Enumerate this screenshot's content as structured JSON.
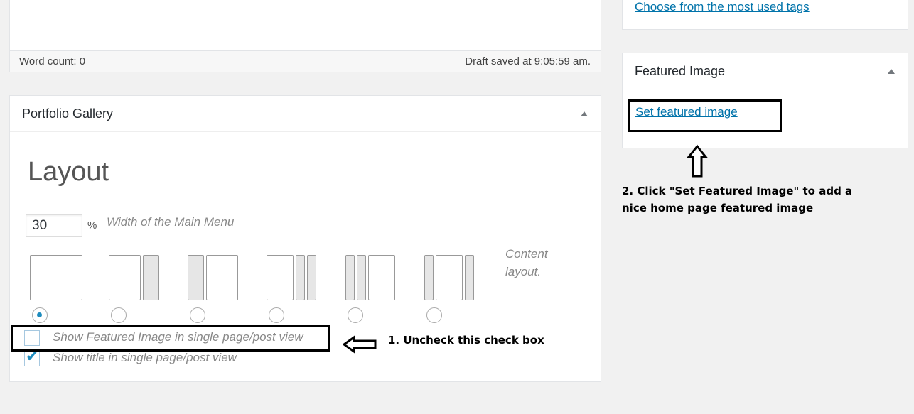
{
  "editor": {
    "word_count": "Word count: 0",
    "draft_status": "Draft saved at 9:05:59 am."
  },
  "portfolio_gallery": {
    "title": "Portfolio Gallery",
    "layout_heading": "Layout",
    "width_value": "30",
    "width_unit": "%",
    "width_label": "Width of the Main Menu",
    "content_layout_label_1": "Content",
    "content_layout_label_2": "layout.",
    "layout_options_selected_index": 0,
    "checkboxes": [
      {
        "label": "Show Featured Image in single page/post view",
        "checked": false
      },
      {
        "label": "Show title in single page/post view",
        "checked": true
      }
    ]
  },
  "sidebar": {
    "tags_link": "Choose from the most used tags",
    "featured_image": {
      "title": "Featured Image",
      "set_link": "Set featured image"
    }
  },
  "annotations": {
    "step1": "1. Uncheck this check box",
    "step2_line1": "2. Click \"Set Featured Image\" to add a",
    "step2_line2": "nice home page featured image"
  },
  "colors": {
    "link": "#0073aa",
    "radio_selected": "#1e8cbe",
    "background": "#f1f1f1"
  }
}
